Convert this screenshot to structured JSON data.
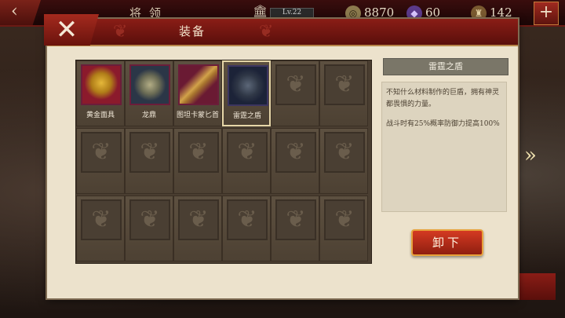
{
  "topbar": {
    "back_icon": "‹",
    "title": "将领",
    "level_label": "Lv.22",
    "gold": "8870",
    "gems": "60",
    "soldiers": "142",
    "plus_icon": "+"
  },
  "dialog": {
    "close_icon": "✕",
    "title": "装备"
  },
  "items": [
    {
      "name": "黄金面具",
      "color": "#c8951e",
      "bg": "#8b1a2c"
    },
    {
      "name": "龙鼎",
      "color": "#9e9a78",
      "bg": "#2b3647"
    },
    {
      "name": "图坦卡蒙匕首",
      "color": "#c89748",
      "bg": "#6a1a33"
    },
    {
      "name": "雷霆之盾",
      "color": "#3a4250",
      "bg": "#1c2338"
    }
  ],
  "empty_slot_icon": "❦",
  "detail": {
    "title": "雷霆之盾",
    "description": "不知什么材料制作的巨盾，拥有神灵都畏惧的力量。",
    "effect": "战斗时有25%概率防御力提高100%"
  },
  "unequip_label": "卸下",
  "side_arrow_icon": "»"
}
